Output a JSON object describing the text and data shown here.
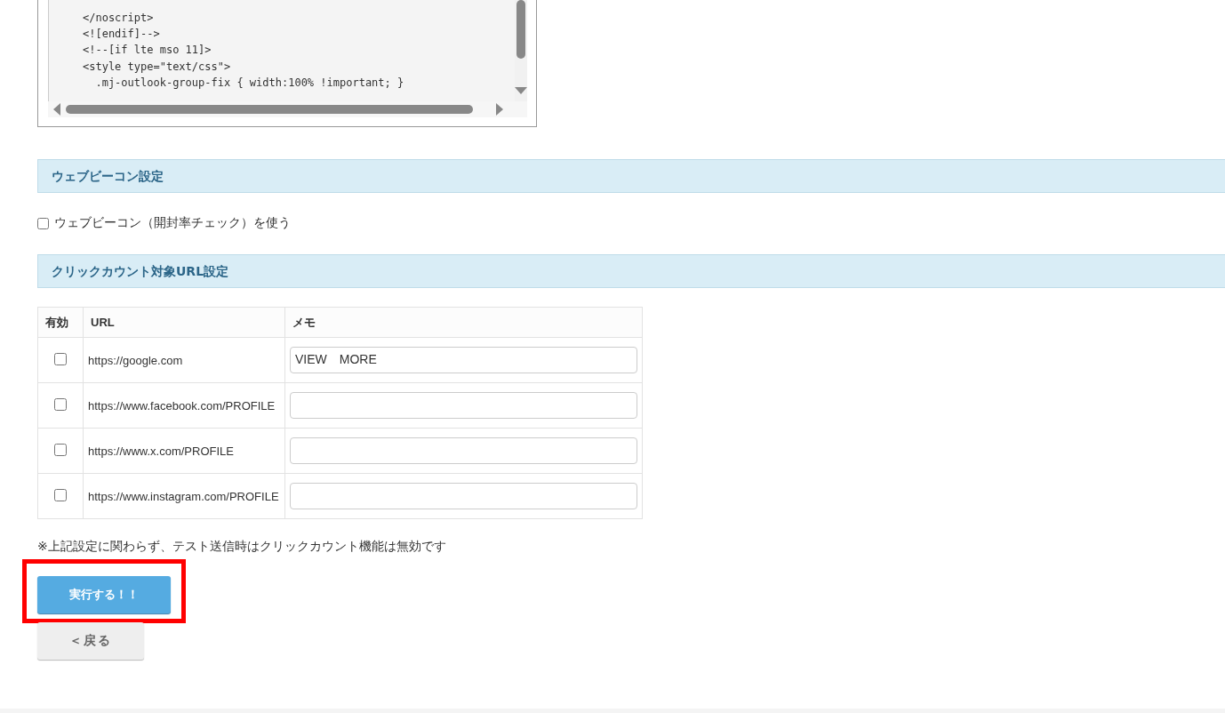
{
  "code_box": {
    "lines": [
      "</noscript>",
      "<![endif]-->",
      "<!--[if lte mso 11]>",
      "<style type=\"text/css\">",
      "  .mj-outlook-group-fix { width:100% !important; }"
    ]
  },
  "web_beacon": {
    "title": "ウェブビーコン設定",
    "checkbox": {
      "label": "ウェブビーコン（開封率チェック）を使う",
      "checked": false
    }
  },
  "click_count": {
    "title": "クリックカウント対象URL設定",
    "table": {
      "columns": [
        "有効",
        "URL",
        "メモ"
      ],
      "rows": [
        {
          "enabled": false,
          "url": "https://google.com",
          "memo": "VIEW　MORE"
        },
        {
          "enabled": false,
          "url": "https://www.facebook.com/PROFILE",
          "memo": ""
        },
        {
          "enabled": false,
          "url": "https://www.x.com/PROFILE",
          "memo": ""
        },
        {
          "enabled": false,
          "url": "https://www.instagram.com/PROFILE",
          "memo": ""
        }
      ]
    },
    "note": "※上記設定に関わらず、テスト送信時はクリックカウント機能は無効です"
  },
  "buttons": [
    {
      "kind": "primary",
      "label": "実行する！！",
      "highlighted": true
    },
    {
      "kind": "back",
      "label": "＜戻る",
      "highlighted": false
    }
  ]
}
